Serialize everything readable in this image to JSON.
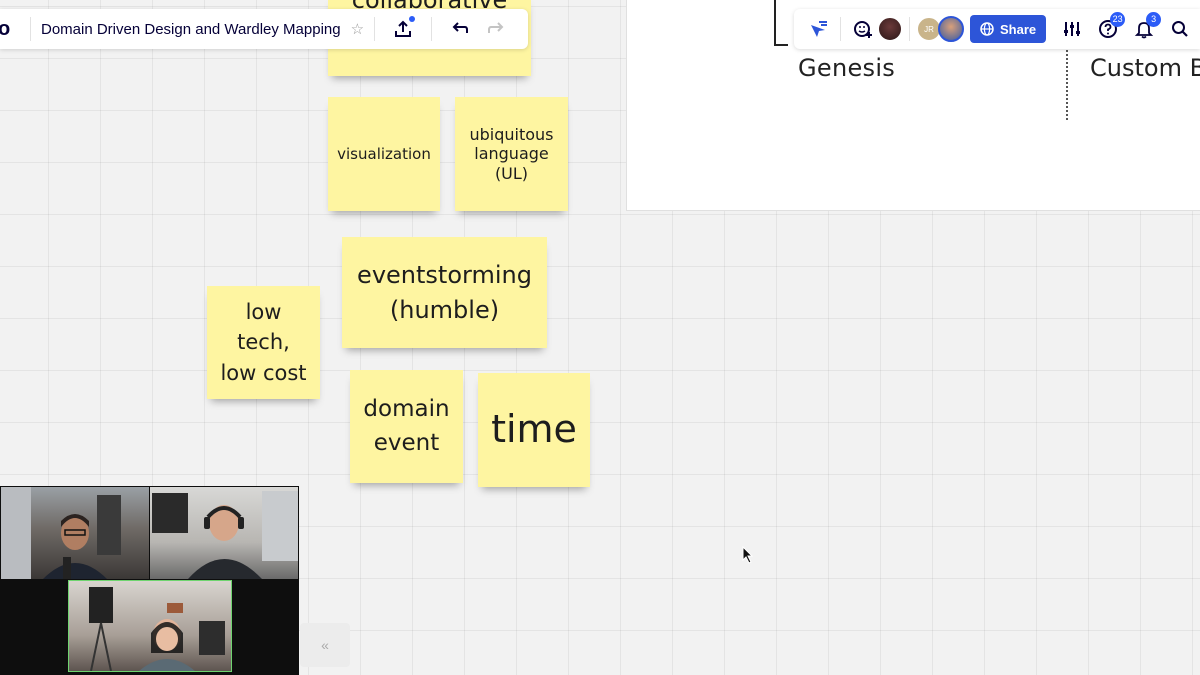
{
  "toolbar": {
    "logo": "o",
    "board_title": "Domain Driven Design and Wardley Mapping",
    "star_icon": "star-icon",
    "export_icon": "upload-icon",
    "undo_icon": "undo-icon",
    "redo_icon": "redo-icon"
  },
  "collab": {
    "avatar_initials": "JR",
    "share_label": "Share",
    "help_count": "23",
    "notifications_count": "3"
  },
  "map": {
    "stage_1": "Genesis",
    "stage_2": "Custom B"
  },
  "stickies": {
    "top": "collaborative",
    "visualization": "visualization",
    "ubiquitous_1": "ubiquitous",
    "ubiquitous_2": "language",
    "ubiquitous_3": "(UL)",
    "eventstorming_1": "eventstorming",
    "eventstorming_2": "(humble)",
    "lowtech_1": "low",
    "lowtech_2": "tech,",
    "lowtech_3": "low cost",
    "domain_1": "domain",
    "domain_2": "event",
    "time": "time"
  },
  "colors": {
    "sticky_yellow": "#fef5a1",
    "share_blue": "#2d55d8",
    "badge_blue": "#2c5cf7"
  },
  "collapse_label": "«"
}
